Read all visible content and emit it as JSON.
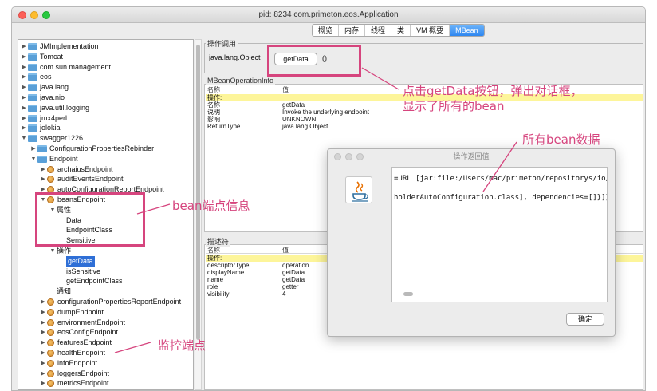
{
  "window": {
    "title": "pid: 8234 com.primeton.eos.Application"
  },
  "tabs": [
    {
      "label": "概览"
    },
    {
      "label": "内存"
    },
    {
      "label": "线程"
    },
    {
      "label": "类"
    },
    {
      "label": "VM 概要"
    },
    {
      "label": "MBean",
      "active": true
    }
  ],
  "tree": [
    {
      "label": "JMImplementation",
      "level": 0,
      "kind": "folder",
      "expanded": false
    },
    {
      "label": "Tomcat",
      "level": 0,
      "kind": "folder",
      "expanded": false
    },
    {
      "label": "com.sun.management",
      "level": 0,
      "kind": "folder",
      "expanded": false
    },
    {
      "label": "eos",
      "level": 0,
      "kind": "folder",
      "expanded": false
    },
    {
      "label": "java.lang",
      "level": 0,
      "kind": "folder",
      "expanded": false
    },
    {
      "label": "java.nio",
      "level": 0,
      "kind": "folder",
      "expanded": false
    },
    {
      "label": "java.util.logging",
      "level": 0,
      "kind": "folder",
      "expanded": false
    },
    {
      "label": "jmx4perl",
      "level": 0,
      "kind": "folder",
      "expanded": false
    },
    {
      "label": "jolokia",
      "level": 0,
      "kind": "folder",
      "expanded": false
    },
    {
      "label": "swagger1226",
      "level": 0,
      "kind": "folder",
      "expanded": true
    },
    {
      "label": "ConfigurationPropertiesRebinder",
      "level": 1,
      "kind": "folder",
      "expanded": false
    },
    {
      "label": "Endpoint",
      "level": 1,
      "kind": "folder",
      "expanded": true
    },
    {
      "label": "archaiusEndpoint",
      "level": 2,
      "kind": "bean",
      "expanded": false
    },
    {
      "label": "auditEventsEndpoint",
      "level": 2,
      "kind": "bean",
      "expanded": false
    },
    {
      "label": "autoConfigurationReportEndpoint",
      "level": 2,
      "kind": "bean",
      "expanded": false
    },
    {
      "label": "beansEndpoint",
      "level": 2,
      "kind": "bean",
      "expanded": true
    },
    {
      "label": "属性",
      "level": 3,
      "kind": "text",
      "expanded": true
    },
    {
      "label": "Data",
      "level": 4,
      "kind": "text"
    },
    {
      "label": "EndpointClass",
      "level": 4,
      "kind": "text"
    },
    {
      "label": "Sensitive",
      "level": 4,
      "kind": "text"
    },
    {
      "label": "操作",
      "level": 3,
      "kind": "text",
      "expanded": true
    },
    {
      "label": "getData",
      "level": 4,
      "kind": "text",
      "selected": true
    },
    {
      "label": "isSensitive",
      "level": 4,
      "kind": "text"
    },
    {
      "label": "getEndpointClass",
      "level": 4,
      "kind": "text"
    },
    {
      "label": "通知",
      "level": 3,
      "kind": "text"
    },
    {
      "label": "configurationPropertiesReportEndpoint",
      "level": 2,
      "kind": "bean",
      "expanded": false
    },
    {
      "label": "dumpEndpoint",
      "level": 2,
      "kind": "bean",
      "expanded": false
    },
    {
      "label": "environmentEndpoint",
      "level": 2,
      "kind": "bean",
      "expanded": false
    },
    {
      "label": "eosConfigEndpoint",
      "level": 2,
      "kind": "bean",
      "expanded": false
    },
    {
      "label": "featuresEndpoint",
      "level": 2,
      "kind": "bean",
      "expanded": false
    },
    {
      "label": "healthEndpoint",
      "level": 2,
      "kind": "bean",
      "expanded": false
    },
    {
      "label": "infoEndpoint",
      "level": 2,
      "kind": "bean",
      "expanded": false
    },
    {
      "label": "loggersEndpoint",
      "level": 2,
      "kind": "bean",
      "expanded": false
    },
    {
      "label": "metricsEndpoint",
      "level": 2,
      "kind": "bean",
      "expanded": false
    }
  ],
  "invoke": {
    "label": "操作调用",
    "return_type": "java.lang.Object",
    "button": "getData",
    "params": "()"
  },
  "op_info": {
    "label": "MBeanOperationInfo",
    "headers": [
      "名称",
      "值"
    ],
    "rows": [
      {
        "name": "操作:",
        "value": "",
        "highlight": true
      },
      {
        "name": "名称",
        "value": "getData"
      },
      {
        "name": "说明",
        "value": "Invoke the underlying endpoint"
      },
      {
        "name": "影响",
        "value": "UNKNOWN"
      },
      {
        "name": "ReturnType",
        "value": "java.lang.Object"
      }
    ]
  },
  "descriptor": {
    "label": "描述符",
    "headers": [
      "名称",
      "值"
    ],
    "rows": [
      {
        "name": "操作:",
        "value": "",
        "highlight": true
      },
      {
        "name": "descriptorType",
        "value": "operation"
      },
      {
        "name": "displayName",
        "value": "getData"
      },
      {
        "name": "name",
        "value": "getData"
      },
      {
        "name": "role",
        "value": "getter"
      },
      {
        "name": "visibility",
        "value": "4"
      }
    ]
  },
  "dialog": {
    "title": "操作返回值",
    "lines": [
      "=URL [jar:file:/Users/mac/primeton/repositorys/io/",
      "holderAutoConfiguration.class], dependencies=[]}]}"
    ],
    "ok": "确定"
  },
  "annotations": {
    "click_getdata_line1": "点击getData按钮，弹出对话框，",
    "click_getdata_line2": "显示了所有的bean",
    "all_bean_data": "所有bean数据",
    "bean_endpoint_info": "bean端点信息",
    "monitor_endpoint": "监控端点",
    "color": "#d6457e"
  }
}
